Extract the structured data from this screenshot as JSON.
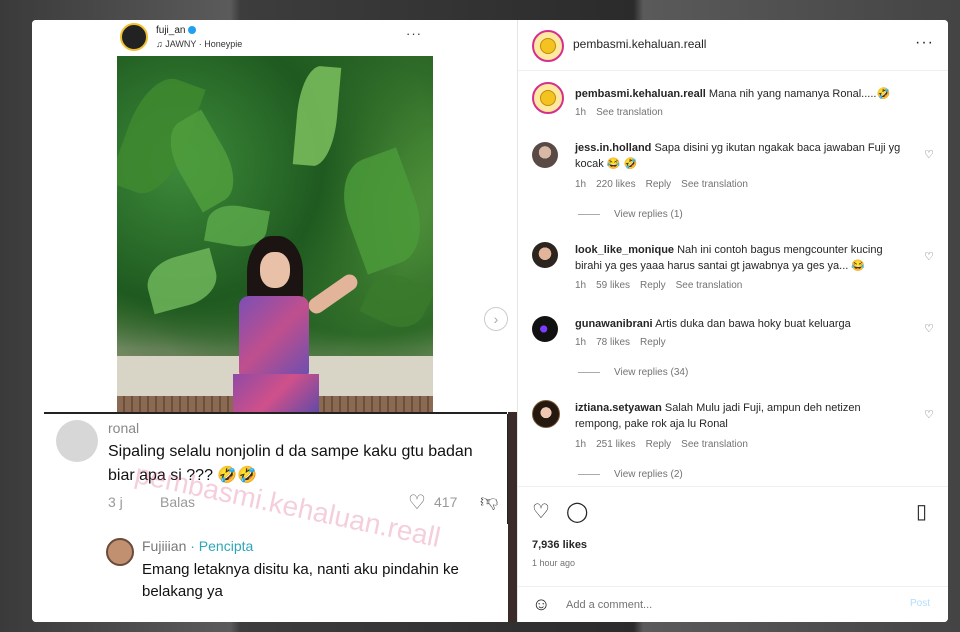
{
  "post_media": {
    "tiktok_username": "fuji_an",
    "tiktok_music": "♫ JAWNY · Honeypie",
    "top_comment": {
      "username": "ronal",
      "text": "Sipaling selalu nonjolin d  da sampe kaku gtu badan biar apa si ??? 🤣🤣",
      "age": "3 j",
      "reply_label": "Balas",
      "likes": "417"
    },
    "reply": {
      "username": "Fujiiian",
      "badge": "· Pencipta",
      "text": "Emang letaknya disitu ka, nanti aku pindahin ke belakang ya"
    },
    "watermark": "pembasmi.kehaluan.reall"
  },
  "header": {
    "username": "pembasmi.kehaluan.reall",
    "more": "···"
  },
  "caption": {
    "username": "pembasmi.kehaluan.reall",
    "text": "Mana nih yang namanya Ronal.....🤣",
    "time": "1h",
    "see_translation": "See translation"
  },
  "comments": [
    {
      "username": "jess.in.holland",
      "text": "Sapa disini yg ikutan ngakak baca jawaban Fuji yg kocak 😂 🤣",
      "time": "1h",
      "likes": "220 likes",
      "reply": "Reply",
      "translation": "See translation",
      "view_replies": "View replies (1)"
    },
    {
      "username": "look_like_monique",
      "text": "Nah ini contoh bagus mengcounter kucing birahi ya ges yaaa harus santai gt jawabnya ya ges ya... 😂",
      "time": "1h",
      "likes": "59 likes",
      "reply": "Reply",
      "translation": "See translation",
      "view_replies": ""
    },
    {
      "username": "gunawanibrani",
      "text": "Artis duka dan bawa hoky buat keluarga",
      "time": "1h",
      "likes": "78 likes",
      "reply": "Reply",
      "translation": "",
      "view_replies": "View replies (34)"
    },
    {
      "username": "iztiana.setyawan",
      "text": "Salah Mulu jadi Fuji, ampun deh netizen rempong, pake rok aja lu Ronal",
      "time": "1h",
      "likes": "251 likes",
      "reply": "Reply",
      "translation": "See translation",
      "view_replies": "View replies (2)"
    }
  ],
  "actions": {
    "likes": "7,936 likes",
    "time": "1 hour ago"
  },
  "add_comment": {
    "placeholder": "Add a comment...",
    "post": "Post"
  },
  "colors": {
    "ig_link": "#0095f6",
    "post_disabled": "#b3dbff",
    "watermark": "#dc5082"
  }
}
